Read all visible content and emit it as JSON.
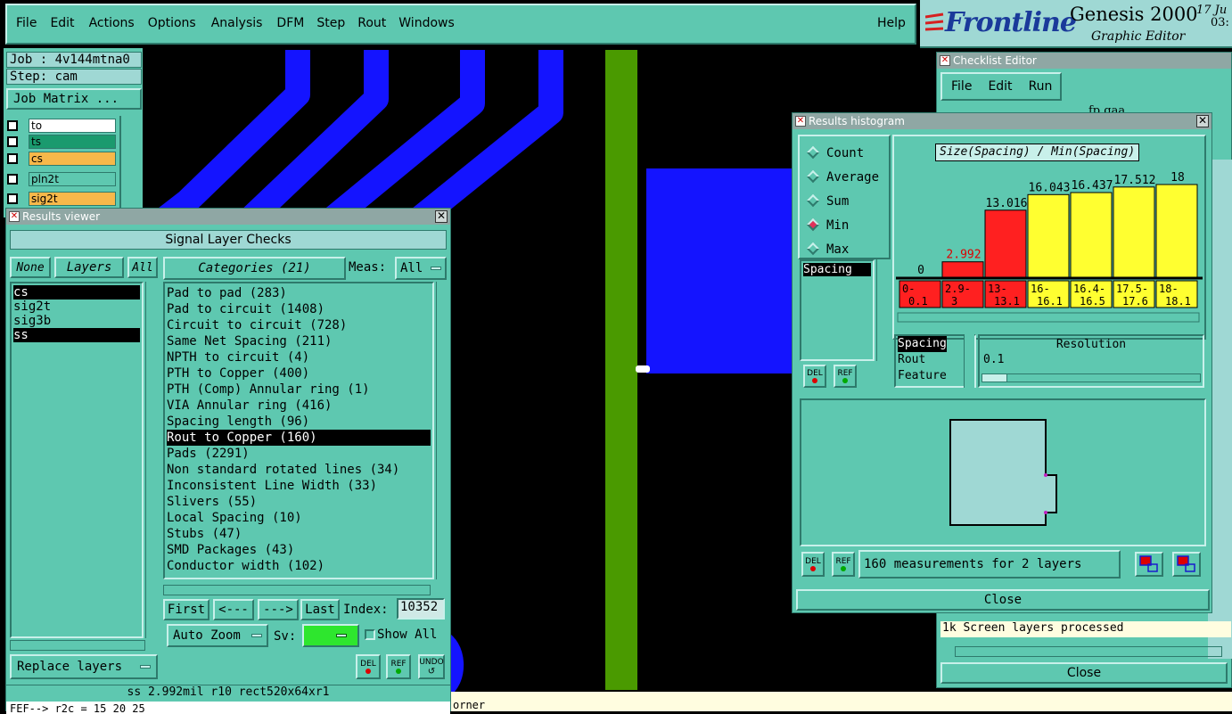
{
  "menubar": {
    "items": [
      "File",
      "Edit",
      "Actions",
      "Options",
      "Analysis",
      "DFM",
      "Step",
      "Rout",
      "Windows"
    ],
    "help": "Help"
  },
  "brand": {
    "logo": "Frontline",
    "product": "Genesis 2000",
    "subtitle": "Graphic Editor",
    "date_part1": "17 Ju",
    "date_part2": "03:"
  },
  "job": {
    "job_label": "Job : 4v144mtna0",
    "step_label": "Step: cam",
    "matrix_button": "Job Matrix ..."
  },
  "layer_list": [
    {
      "name": "to",
      "color": "#ffffff"
    },
    {
      "name": "ts",
      "color": "#1a9a6e"
    },
    {
      "name": "cs",
      "color": "#f7b84a"
    },
    {
      "name": "pln2t",
      "color": "#5ec8b0"
    },
    {
      "name": "sig2t",
      "color": "#f7b84a"
    }
  ],
  "results_viewer": {
    "title": "Results viewer",
    "header": "Signal Layer Checks",
    "none_btn": "None",
    "layers_btn": "Layers",
    "all_btn": "All",
    "categories_btn": "Categories (21)",
    "meas_label": "Meas:",
    "meas_value": "All",
    "layers": [
      "cs",
      "sig2t",
      "sig3b",
      "ss"
    ],
    "categories": [
      "Pad to pad (283)",
      "Pad to circuit (1408)",
      "Circuit to circuit (728)",
      "Same Net Spacing (211)",
      "NPTH to circuit (4)",
      "PTH to Copper (400)",
      "PTH (Comp) Annular ring (1)",
      "VIA Annular ring (416)",
      "Spacing length (96)",
      "Rout to Copper (160)",
      "Pads (2291)",
      "Non standard rotated lines (34)",
      "Inconsistent Line Width (33)",
      "Slivers (55)",
      "Local Spacing (10)",
      "Stubs (47)",
      "SMD Packages (43)",
      "Conductor width (102)"
    ],
    "nav": {
      "first": "First",
      "prev": "<---",
      "next": "--->",
      "last": "Last",
      "index_label": "Index:",
      "index_value": "10352"
    },
    "autozoom": "Auto Zoom",
    "sv_label": "Sv:",
    "show_all": "Show All",
    "replace_layers": "Replace layers",
    "del": "DEL",
    "ref": "REF",
    "undo": "UNDO",
    "status": "ss 2.992mil   r10   rect520x64xr1"
  },
  "command_line": "FEF--> r2c = 15 20 25",
  "bottom_status": "orner",
  "checklist": {
    "title": "Checklist Editor",
    "menu": [
      "File",
      "Edit",
      "Run"
    ],
    "top_text": "fp gaa",
    "status": "1k Screen layers processed",
    "close": "Close"
  },
  "histogram": {
    "title": "Results histogram",
    "modes": [
      {
        "label": "Count",
        "on": false
      },
      {
        "label": "Average",
        "on": false
      },
      {
        "label": "Sum",
        "on": false
      },
      {
        "label": "Min",
        "on": true
      },
      {
        "label": "Max",
        "on": false
      }
    ],
    "param_list": [
      "Spacing"
    ],
    "del": "DEL",
    "ref": "REF",
    "chart_title": "Size(Spacing) / Min(Spacing)",
    "resolution_label": "Resolution",
    "resolution_value": "0.1",
    "measure_types": [
      "Spacing",
      "Rout",
      "Feature"
    ],
    "measurements": "160 measurements for 2 layers",
    "close": "Close"
  },
  "chart_data": {
    "type": "bar",
    "title": "Size(Spacing) / Min(Spacing)",
    "categories": [
      "0-0.1",
      "2.9-3",
      "13-13.1",
      "16-16.1",
      "16.4-16.5",
      "17.5-17.6",
      "18-18.1"
    ],
    "values": [
      0,
      2.992,
      13.016,
      16.043,
      16.437,
      17.512,
      18
    ],
    "labels": [
      "0",
      "2.992",
      "13.016",
      "16.043",
      "16.437",
      "17.512",
      "18"
    ],
    "colors": [
      "#ff2020",
      "#ff2020",
      "#ff2020",
      "#ffff30",
      "#ffff30",
      "#ffff30",
      "#ffff30"
    ],
    "ylim": [
      0,
      18
    ]
  }
}
